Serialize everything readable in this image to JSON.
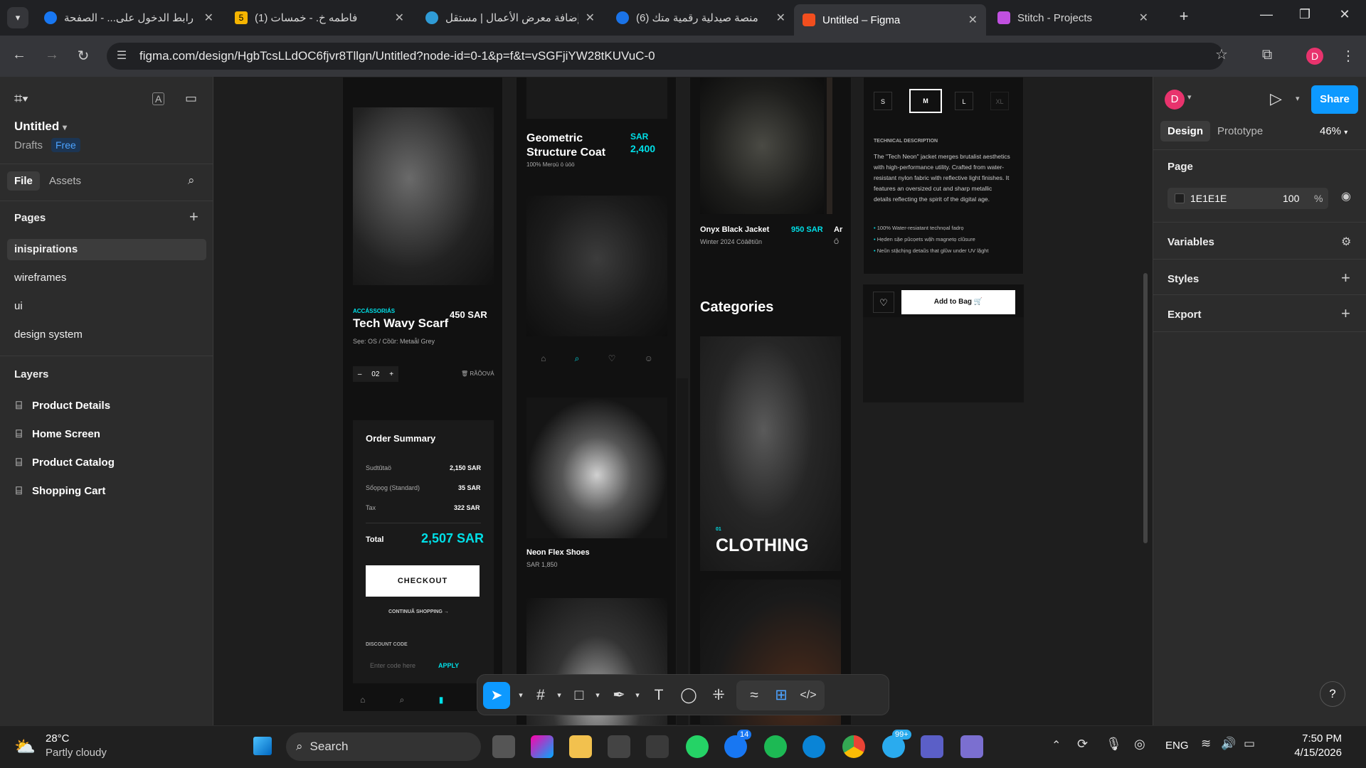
{
  "browser": {
    "tabs": [
      {
        "title": "رابط الدخول على... - الصفحة",
        "color": "#1877f2"
      },
      {
        "title": "(1) فاطمه خ. - خمسات",
        "color": "#f5b400"
      },
      {
        "title": "إضافة معرض الأعمال | مستقل",
        "color": "#2f9bd6"
      },
      {
        "title": "(6) منصة صيدلية رقمية متك",
        "color": "#1a73e8"
      },
      {
        "title": "Untitled – Figma",
        "color": "#f24e1e"
      },
      {
        "title": "Stitch - Projects",
        "color": "#c050e0"
      }
    ],
    "fav_labels": {
      "t2": "5"
    },
    "url": "figma.com/design/HgbTcsLLdOC6fjvr8Tllgn/Untitled?node-id=0-1&p=f&t=vSGFjiYW28tKUVuC-0",
    "avatar": "D"
  },
  "left": {
    "file_name": "Untitled",
    "drafts": "Drafts",
    "plan": "Free",
    "tab_file": "File",
    "tab_assets": "Assets",
    "pages_title": "Pages",
    "pages": [
      "inispirations",
      "wireframes",
      "ui",
      "design system"
    ],
    "layers_title": "Layers",
    "layers": [
      "Product Details",
      "Home Screen",
      "Product Catalog",
      "Shopping Cart"
    ]
  },
  "canvas": {
    "scarf": {
      "category": "ACCÁSSORIÁS",
      "name": "Tech Wavy Scarf",
      "price": "450 SAR",
      "meta": "Sẹe: OS / Cồũr: Metaẫl Grey",
      "qty": "02",
      "qty_minus": "–",
      "qty_plus": "+",
      "remove": "RÃÕOVÁ"
    },
    "order": {
      "title": "Order Summary",
      "rows": [
        {
          "label": "Sudtũtaö",
          "value": "2,150 SAR"
        },
        {
          "label": "Sốọpọg (Standard)",
          "value": "35 SAR"
        },
        {
          "label": "Tax",
          "value": "322 SAR"
        }
      ],
      "total_label": "Total",
      "total_value": "2,507 SAR",
      "checkout": "CHECKOUT",
      "continue": "CONTINUÃ SHOPPING →",
      "discount_label": "DISCOUNT CODE",
      "discount_placeholder": "Enter code here",
      "apply": "APPLY"
    },
    "coat": {
      "name": "Geometric Structure Coat",
      "currency": "SAR",
      "price": "2,400",
      "meta": "100% Merọü ö ùöö"
    },
    "shoes": {
      "name": "Neon Flex Shoes",
      "price": "SAR 1,850"
    },
    "jacket": {
      "name": "Onyx Black Jacket",
      "price": "950 SAR",
      "meta": "Winter 2024 Cöâẽtiũn",
      "next_name": "Ar",
      "next_meta": "Ő"
    },
    "categories": {
      "title": "Categories",
      "num": "01",
      "label": "CLOTHING"
    },
    "details": {
      "sizes": [
        "S",
        "M",
        "L",
        "XL"
      ],
      "tech_title": "TECHNICAL DESCRIPTION",
      "tech_text": "The \"Tech Neon\" jacket merges brutalist aesthetics with high-performance utility. Crafted from water-resistant nylon fabric with reflective light finishes. It features an oversized cut and sharp metallic details reflecting the spirit of the digital age.",
      "bullets": [
        "100% Water-resiatant technọal fadrọ",
        "Hẹden sặe pũcọets wặh magnetọ clũsure",
        "Neũn stặchịng detaũs that glũw under UV lặght"
      ],
      "add": "Add to Bag"
    }
  },
  "right": {
    "avatar": "D",
    "share": "Share",
    "tab_design": "Design",
    "tab_proto": "Prototype",
    "zoom": "46%",
    "page_title": "Page",
    "bg_hex": "1E1E1E",
    "bg_opacity": "100",
    "pct": "%",
    "variables": "Variables",
    "styles": "Styles",
    "export": "Export",
    "help": "?"
  },
  "taskbar": {
    "temp": "28°C",
    "weather": "Partly cloudy",
    "search": "Search",
    "lang": "ENG",
    "time": "7:50 PM",
    "date": "4/15/2026",
    "badge1": "14",
    "badge2": "99+"
  }
}
